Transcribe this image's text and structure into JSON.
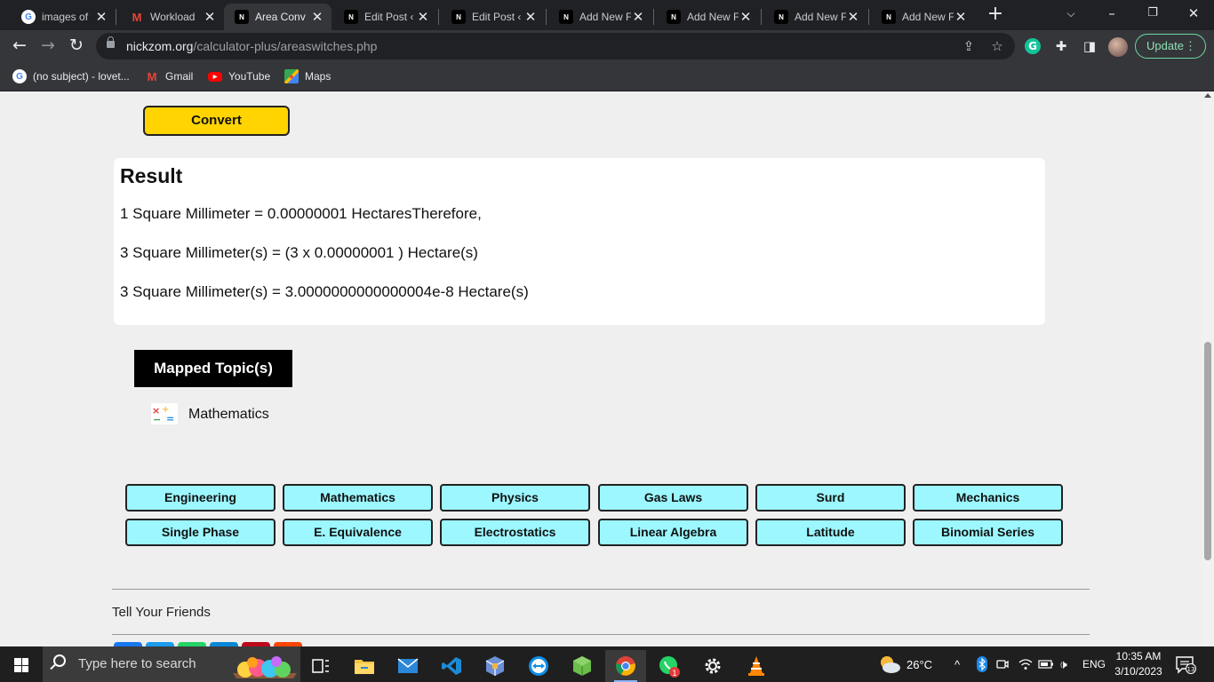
{
  "browser": {
    "tabs": [
      {
        "title": "images of",
        "favicon": "google-icon"
      },
      {
        "title": "Workload",
        "favicon": "gmail-icon"
      },
      {
        "title": "Area Conv",
        "favicon": "nickzom-icon",
        "active": true
      },
      {
        "title": "Edit Post ‹",
        "favicon": "nickzom-icon"
      },
      {
        "title": "Edit Post ‹",
        "favicon": "nickzom-icon"
      },
      {
        "title": "Add New F",
        "favicon": "nickzom-icon"
      },
      {
        "title": "Add New F",
        "favicon": "nickzom-icon"
      },
      {
        "title": "Add New F",
        "favicon": "nickzom-icon"
      },
      {
        "title": "Add New F",
        "favicon": "nickzom-icon"
      }
    ],
    "url_host": "nickzom.org",
    "url_path": "/calculator-plus/areaswitches.php",
    "update_label": "Update",
    "bookmarks": [
      {
        "label": "(no subject) - lovet...",
        "icon": "google-icon"
      },
      {
        "label": "Gmail",
        "icon": "gmail-icon"
      },
      {
        "label": "YouTube",
        "icon": "youtube-icon"
      },
      {
        "label": "Maps",
        "icon": "maps-icon"
      }
    ]
  },
  "page": {
    "convert_label": "Convert",
    "result": {
      "title": "Result",
      "lines": [
        "1 Square Millimeter = 0.00000001  HectaresTherefore,",
        "3 Square Millimeter(s) = (3 x 0.00000001 ) Hectare(s)",
        "3 Square Millimeter(s) = 3.0000000000000004e-8 Hectare(s)"
      ]
    },
    "mapped_topics_label": "Mapped Topic(s)",
    "mapped_topic": "Mathematics",
    "categories": [
      "Engineering",
      "Mathematics",
      "Physics",
      "Gas Laws",
      "Surd",
      "Mechanics",
      "Single Phase",
      "E. Equivalence",
      "Electrostatics",
      "Linear Algebra",
      "Latitude",
      "Binomial Series"
    ],
    "tell_friends": "Tell Your Friends"
  },
  "taskbar": {
    "search_placeholder": "Type here to search",
    "weather_temp": "26°C",
    "language": "ENG",
    "time": "10:35 AM",
    "date": "3/10/2023",
    "notification_count": "13",
    "whatsapp_badge": "1"
  },
  "colors": {
    "convert_button": "#ffd400",
    "category_chip": "#9cf7ff",
    "update_accent": "#8ee0b3"
  }
}
